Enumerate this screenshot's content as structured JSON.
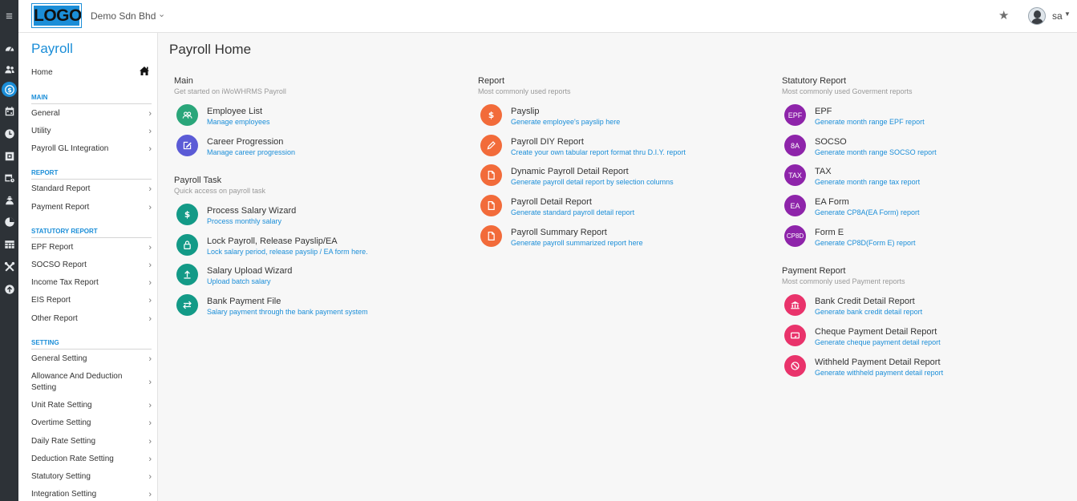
{
  "topbar": {
    "logo_text": "LOGO",
    "company": "Demo Sdn Bhd",
    "company_caret": "⌄",
    "user": "sa",
    "user_caret": "▼",
    "hamburger": "≡",
    "star": "★"
  },
  "colors": {
    "accent": "#1b8ed8",
    "green": "#2aa67a",
    "indigo": "#5b5bd6",
    "teal": "#139a87",
    "orange": "#f26b3a",
    "purple": "#8e24aa",
    "pink": "#e9336b",
    "rail": "#2d3237"
  },
  "rail": {
    "icons": [
      "dashboard-icon",
      "people-icon",
      "payroll-icon",
      "calendar-icon",
      "clock-icon",
      "claim-icon",
      "schedule-icon",
      "training-icon",
      "chart-icon",
      "table-icon",
      "tools-icon",
      "upload-icon"
    ],
    "active_index": 2
  },
  "sidebar": {
    "title": "Payroll",
    "home": "Home",
    "chevron": "›",
    "main_label": "MAIN",
    "main_items": [
      "General",
      "Utility",
      "Payroll GL Integration"
    ],
    "report_label": "REPORT",
    "report_items": [
      "Standard Report",
      "Payment Report"
    ],
    "statutory_label": "STATUTORY REPORT",
    "statutory_items": [
      "EPF Report",
      "SOCSO Report",
      "Income Tax Report",
      "EIS Report",
      "Other Report"
    ],
    "setting_label": "SETTING",
    "setting_items": [
      "General Setting",
      "Allowance And Deduction Setting",
      "Unit Rate Setting",
      "Overtime Setting",
      "Daily Rate Setting",
      "Deduction Rate Setting",
      "Statutory Setting",
      "Integration Setting"
    ]
  },
  "page": {
    "title": "Payroll Home"
  },
  "groups": {
    "main": {
      "title": "Main",
      "subtitle": "Get started on iWoWHRMS Payroll",
      "items": [
        {
          "title": "Employee List",
          "sub": "Manage employees",
          "icon": "users-icon",
          "color": "green"
        },
        {
          "title": "Career Progression",
          "sub": "Manage career progression",
          "icon": "edit-icon",
          "color": "indigo"
        }
      ]
    },
    "task": {
      "title": "Payroll Task",
      "subtitle": "Quick access on payroll task",
      "items": [
        {
          "title": "Process Salary Wizard",
          "sub": "Process monthly salary",
          "icon": "dollar-icon",
          "color": "teal"
        },
        {
          "title": "Lock Payroll, Release Payslip/EA",
          "sub": "Lock salary period, release payslip / EA form here.",
          "icon": "lock-icon",
          "color": "teal"
        },
        {
          "title": "Salary Upload Wizard",
          "sub": "Upload batch salary",
          "icon": "upload-icon",
          "color": "teal"
        },
        {
          "title": "Bank Payment File",
          "sub": "Salary payment through the bank payment system",
          "icon": "transfer-icon",
          "color": "teal"
        }
      ]
    },
    "report": {
      "title": "Report",
      "subtitle": "Most commonly used reports",
      "items": [
        {
          "title": "Payslip",
          "sub": "Generate employee's payslip here",
          "icon": "dollar-icon",
          "color": "orange"
        },
        {
          "title": "Payroll DIY Report",
          "sub": "Create your own tabular report format thru D.I.Y. report",
          "icon": "pencil-icon",
          "color": "orange"
        },
        {
          "title": "Dynamic Payroll Detail Report",
          "sub": "Generate payroll detail report by selection columns",
          "icon": "file-icon",
          "color": "orange"
        },
        {
          "title": "Payroll Detail Report",
          "sub": "Generate standard payroll detail report",
          "icon": "file-icon",
          "color": "orange"
        },
        {
          "title": "Payroll Summary Report",
          "sub": "Generate payroll summarized report here",
          "icon": "file-icon",
          "color": "orange"
        }
      ]
    },
    "statutory": {
      "title": "Statutory Report",
      "subtitle": "Most commonly used Goverment reports",
      "items": [
        {
          "title": "EPF",
          "sub": "Generate month range EPF report",
          "badge": "EPF",
          "color": "purple"
        },
        {
          "title": "SOCSO",
          "sub": "Generate month range SOCSO report",
          "badge": "8A",
          "color": "purple"
        },
        {
          "title": "TAX",
          "sub": "Generate month range tax report",
          "badge": "TAX",
          "color": "purple"
        },
        {
          "title": "EA Form",
          "sub": "Generate CP8A(EA Form) report",
          "badge": "EA",
          "color": "purple"
        },
        {
          "title": "Form E",
          "sub": "Generate CP8D(Form E) report",
          "badge": "CP8D",
          "color": "purple"
        }
      ]
    },
    "payment": {
      "title": "Payment Report",
      "subtitle": "Most commonly used Payment reports",
      "items": [
        {
          "title": "Bank Credit Detail Report",
          "sub": "Generate bank credit detail report",
          "icon": "bank-icon",
          "color": "pink"
        },
        {
          "title": "Cheque Payment Detail Report",
          "sub": "Generate cheque payment detail report",
          "icon": "cheque-icon",
          "color": "pink"
        },
        {
          "title": "Withheld Payment Detail Report",
          "sub": "Generate withheld payment detail report",
          "icon": "ban-icon",
          "color": "pink"
        }
      ]
    }
  }
}
